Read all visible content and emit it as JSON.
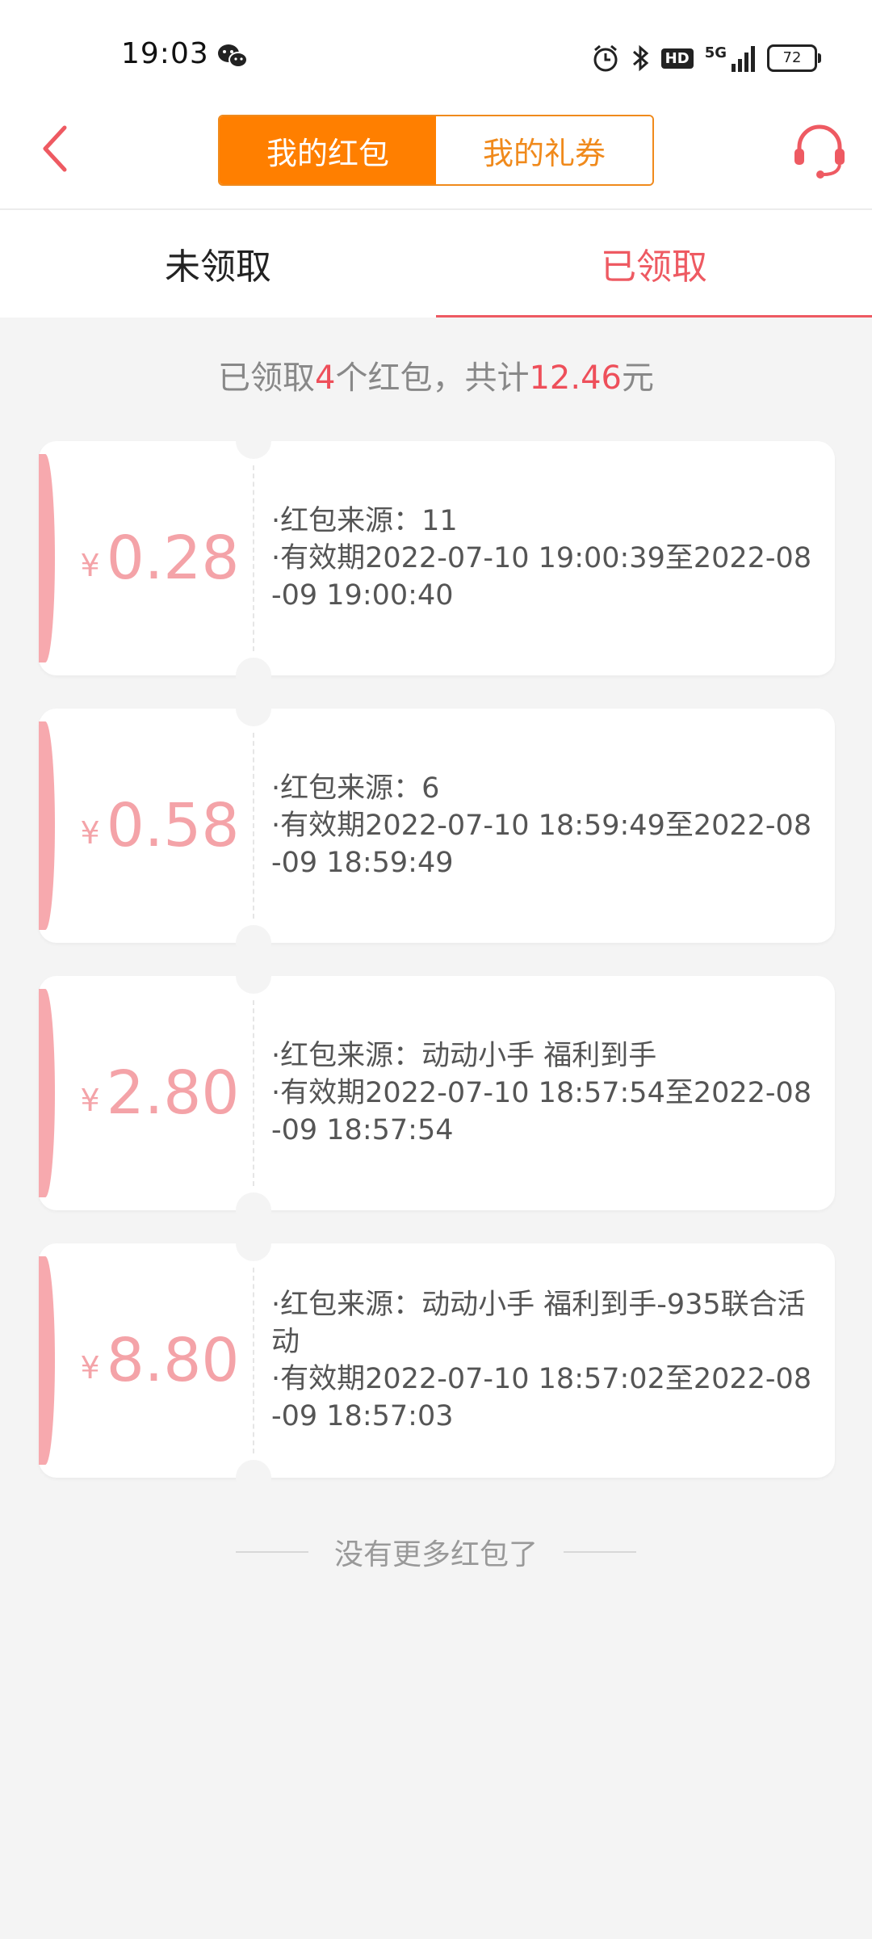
{
  "status_bar": {
    "time": "19:03",
    "hd_label": "HD",
    "network_label": "5G",
    "battery": "72"
  },
  "nav": {
    "segments": [
      "我的红包",
      "我的礼券"
    ],
    "active_segment": 0
  },
  "tabs": {
    "unclaimed": "未领取",
    "claimed": "已领取",
    "active": "claimed"
  },
  "summary": {
    "prefix": "已领取",
    "count": "4",
    "middle": "个红包，共计",
    "total": "12.46",
    "suffix": "元"
  },
  "cards": [
    {
      "currency": "¥",
      "amount": "0.28",
      "source": "·红包来源：11",
      "validity": "·有效期2022-07-10 19:00:39至2022-08-09 19:00:40"
    },
    {
      "currency": "¥",
      "amount": "0.58",
      "source": "·红包来源：6",
      "validity": "·有效期2022-07-10 18:59:49至2022-08-09 18:59:49"
    },
    {
      "currency": "¥",
      "amount": "2.80",
      "source": "·红包来源：动动小手 福利到手",
      "validity": "·有效期2022-07-10 18:57:54至2022-08-09 18:57:54"
    },
    {
      "currency": "¥",
      "amount": "8.80",
      "source": "·红包来源：动动小手 福利到手-935联合活动",
      "validity": "·有效期2022-07-10 18:57:02至2022-08-09 18:57:03"
    }
  ],
  "end_text": "没有更多红包了",
  "colors": {
    "accent_orange": "#ff7f00",
    "accent_red": "#ee5a62",
    "amount_pink": "#f4a3a8"
  },
  "icons": {
    "back": "chevron-left-icon",
    "customer_service": "headset-icon",
    "wechat": "wechat-icon",
    "alarm": "alarm-icon",
    "bluetooth": "bluetooth-icon",
    "signal": "signal-icon",
    "battery": "battery-icon"
  }
}
